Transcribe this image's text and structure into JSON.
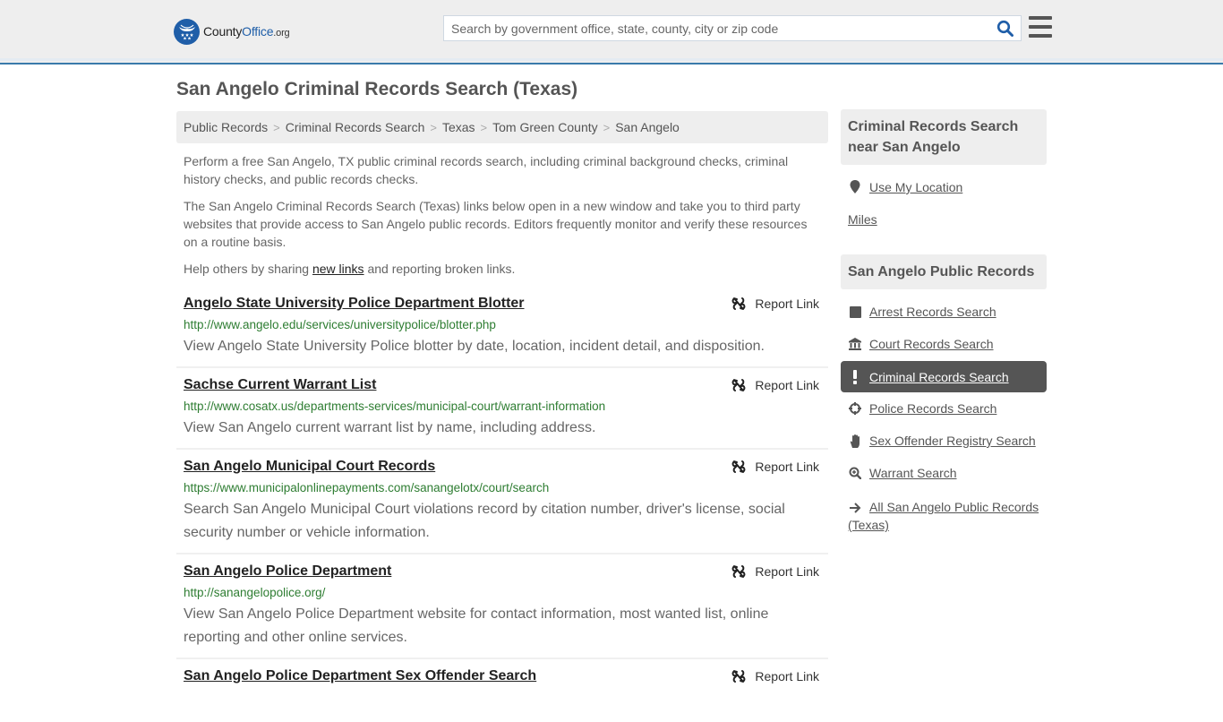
{
  "header": {
    "logo": {
      "name_part1": "County",
      "name_part2": "Office",
      "tld": ".org"
    },
    "search": {
      "placeholder": "Search by government office, state, county, city or zip code",
      "value": ""
    },
    "icons": {
      "search": "search-icon",
      "menu": "hamburger-menu-icon"
    }
  },
  "page": {
    "title": "San Angelo Criminal Records Search (Texas)"
  },
  "breadcrumb": [
    {
      "label": "Public Records"
    },
    {
      "label": "Criminal Records Search"
    },
    {
      "label": "Texas"
    },
    {
      "label": "Tom Green County"
    },
    {
      "label": "San Angelo"
    }
  ],
  "breadcrumb_separator": ">",
  "intro": {
    "p1": "Perform a free San Angelo, TX public criminal records search, including criminal background checks, criminal history checks, and public records checks.",
    "p2": "The San Angelo Criminal Records Search (Texas) links below open in a new window and take you to third party websites that provide access to San Angelo public records. Editors frequently monitor and verify these resources on a routine basis.",
    "p3_before": "Help others by sharing ",
    "p3_link": "new links",
    "p3_after": " and reporting broken links."
  },
  "report_link_label": "Report Link",
  "results": [
    {
      "title": "Angelo State University Police Department Blotter",
      "url": "http://www.angelo.edu/services/universitypolice/blotter.php",
      "description": "View Angelo State University Police blotter by date, location, incident detail, and disposition."
    },
    {
      "title": "Sachse Current Warrant List",
      "url": "http://www.cosatx.us/departments-services/municipal-court/warrant-information",
      "description": "View San Angelo current warrant list by name, including address."
    },
    {
      "title": "San Angelo Municipal Court Records",
      "url": "https://www.municipalonlinepayments.com/sanangelotx/court/search",
      "description": "Search San Angelo Municipal Court violations record by citation number, driver's license, social security number or vehicle information."
    },
    {
      "title": "San Angelo Police Department",
      "url": "http://sanangelopolice.org/",
      "description": "View San Angelo Police Department website for contact information, most wanted list, online reporting and other online services."
    },
    {
      "title": "San Angelo Police Department Sex Offender Search",
      "url": "",
      "description": ""
    }
  ],
  "sidebar": {
    "nearby": {
      "heading": "Criminal Records Search near San Angelo",
      "use_location": "Use My Location",
      "miles": "Miles"
    },
    "public_records": {
      "heading": "San Angelo Public Records",
      "items": [
        {
          "label": "Arrest Records Search",
          "icon": "square-icon",
          "active": false
        },
        {
          "label": "Court Records Search",
          "icon": "courthouse-icon",
          "active": false
        },
        {
          "label": "Criminal Records Search",
          "icon": "exclamation-icon",
          "active": true
        },
        {
          "label": "Police Records Search",
          "icon": "crosshairs-icon",
          "active": false
        },
        {
          "label": "Sex Offender Registry Search",
          "icon": "hand-icon",
          "active": false
        },
        {
          "label": "Warrant Search",
          "icon": "zoom-in-icon",
          "active": false
        },
        {
          "label": "All San Angelo Public Records (Texas)",
          "icon": "arrow-right-icon",
          "active": false
        }
      ]
    }
  },
  "colors": {
    "brand_blue": "#1f5ea8",
    "header_bg": "#eeeeee",
    "header_border": "#3a7aaa",
    "url_green": "#2e7d32",
    "active_item_bg": "#555555"
  }
}
